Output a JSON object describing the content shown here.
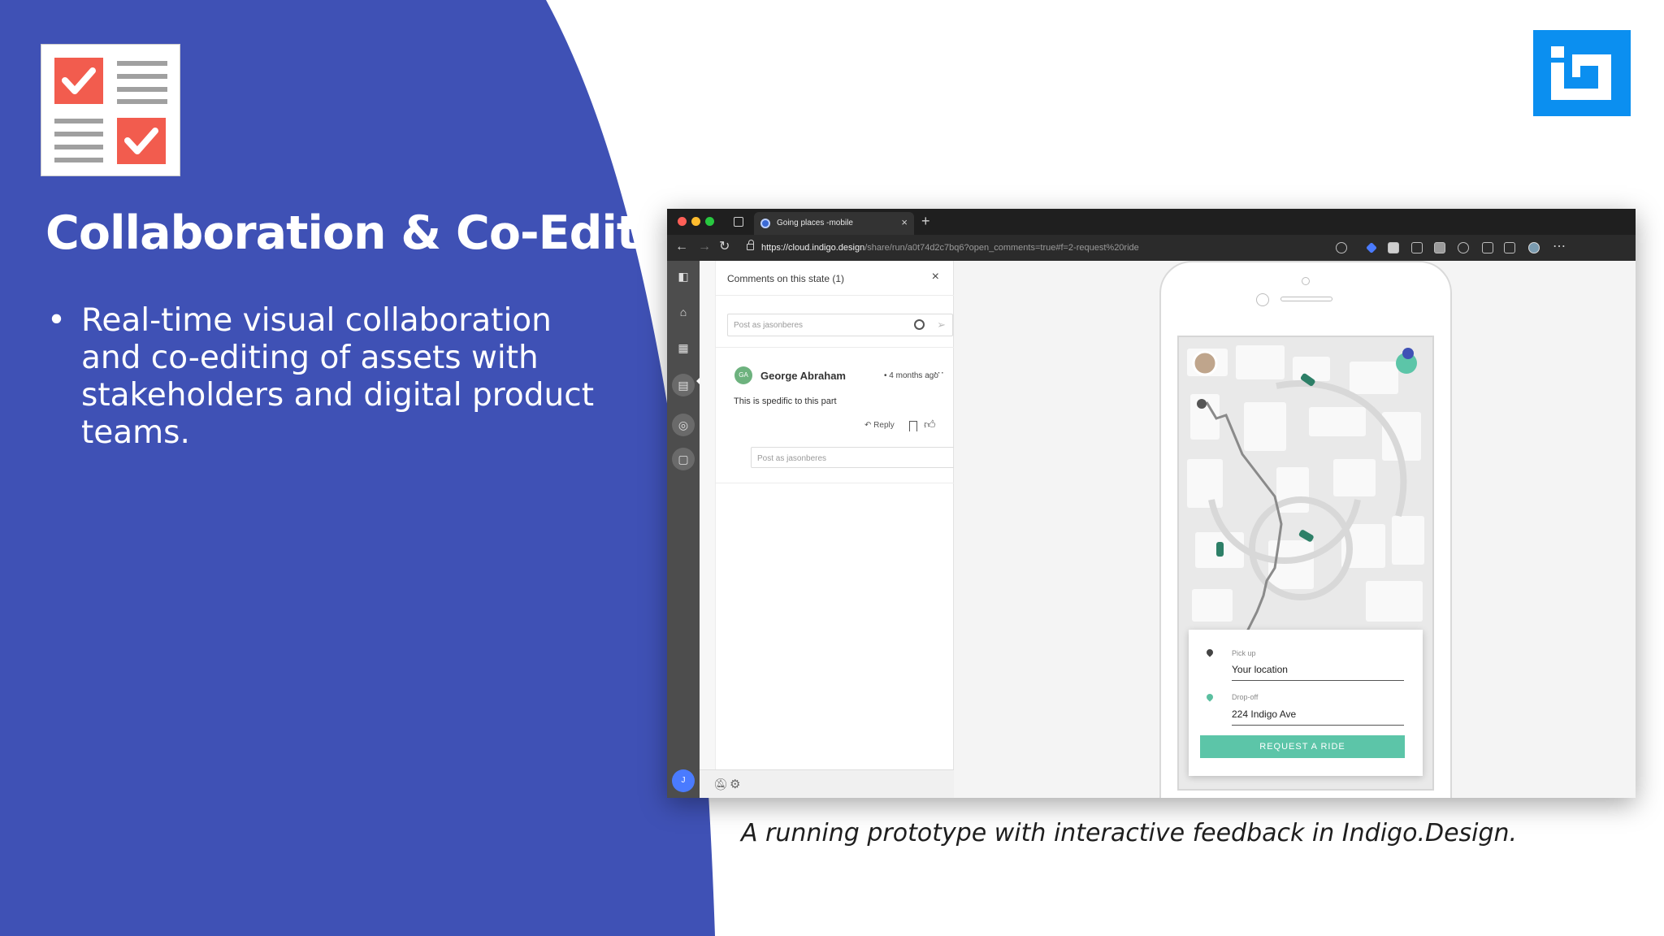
{
  "slide": {
    "title": "Collaboration & Co-Editing",
    "bullets": [
      "Real-time visual collaboration and co-editing of assets with stakeholders and digital product teams."
    ],
    "caption": "A running prototype with interactive feedback in Indigo.Design.",
    "colors": {
      "panel": "#3f51b5",
      "brand": "#0b8ff0",
      "check": "#f25c4e"
    }
  },
  "browser": {
    "tab_title": "Going places -mobile",
    "tab_close": "×",
    "new_tab": "+",
    "url_host": "https://cloud.indigo.design",
    "url_path": "/share/run/a0t74d2c7bq6?open_comments=true#f=2-request%20ride",
    "more": "⋯"
  },
  "sidebar": {
    "icons": [
      "panel-icon",
      "home-icon",
      "grid-icon",
      "comments-icon",
      "target-icon",
      "note-icon"
    ],
    "user_initial": "J"
  },
  "comments": {
    "title": "Comments on this state (1)",
    "close": "×",
    "post_placeholder": "Post as jasonberes",
    "thread": {
      "avatar_initials": "GA",
      "author": "George Abraham",
      "time": "• 4 months ago",
      "more": "⋯",
      "text": "This is spedific to this part",
      "reply_label": "↶ Reply"
    },
    "reply_placeholder": "Post as jasonberes"
  },
  "prototype": {
    "pickup_label": "Pick up",
    "pickup_value": "Your location",
    "dropoff_label": "Drop-off",
    "dropoff_value": "224 Indigo Ave",
    "request_button": "REQUEST A RIDE"
  }
}
